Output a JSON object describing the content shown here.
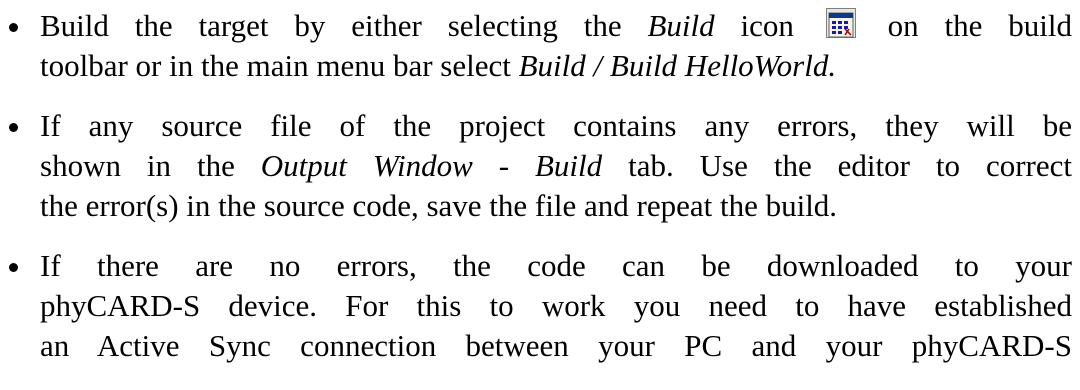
{
  "bullets": [
    {
      "lines": [
        {
          "text": "Build the target by either selecting the ",
          "em": "Build",
          "after": " icon",
          "icon": "build-icon",
          "tail": " on the build"
        },
        {
          "text": "toolbar or in the main menu bar select ",
          "em": "Build / Build HelloWorld.",
          "after": ""
        }
      ]
    },
    {
      "lines": [
        {
          "text": "If any source file of the project contains any errors, they will be"
        },
        {
          "text": "shown in the ",
          "em": "Output Window",
          "after": " - ",
          "em2": "Build",
          "tail": " tab. Use the editor to correct"
        },
        {
          "text": "the error(s) in the source code, save the file and repeat the build."
        }
      ]
    },
    {
      "lines": [
        {
          "text": "If there are no errors, the code can be downloaded to your"
        },
        {
          "text": "phyCARD-S device. For this to work you need to have established"
        },
        {
          "text": "an Active Sync connection between your PC and your phyCARD-S"
        }
      ]
    }
  ]
}
